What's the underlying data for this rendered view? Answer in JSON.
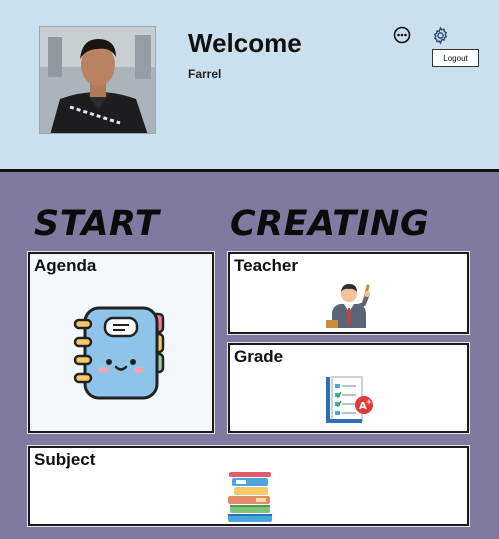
{
  "header": {
    "welcome": "Welcome",
    "username": "Farrel",
    "logout_label": "Logout",
    "icons": [
      "more-options-icon",
      "settings-gear-icon"
    ]
  },
  "banner": {
    "word1": "START",
    "word2": "CREATING"
  },
  "cards": {
    "agenda": "Agenda",
    "teacher": "Teacher",
    "grade": "Grade",
    "subject": "Subject"
  },
  "colors": {
    "header_bg": "#cbe0ee",
    "body_bg": "#7f7aa0",
    "card_bg": "#ffffff"
  }
}
